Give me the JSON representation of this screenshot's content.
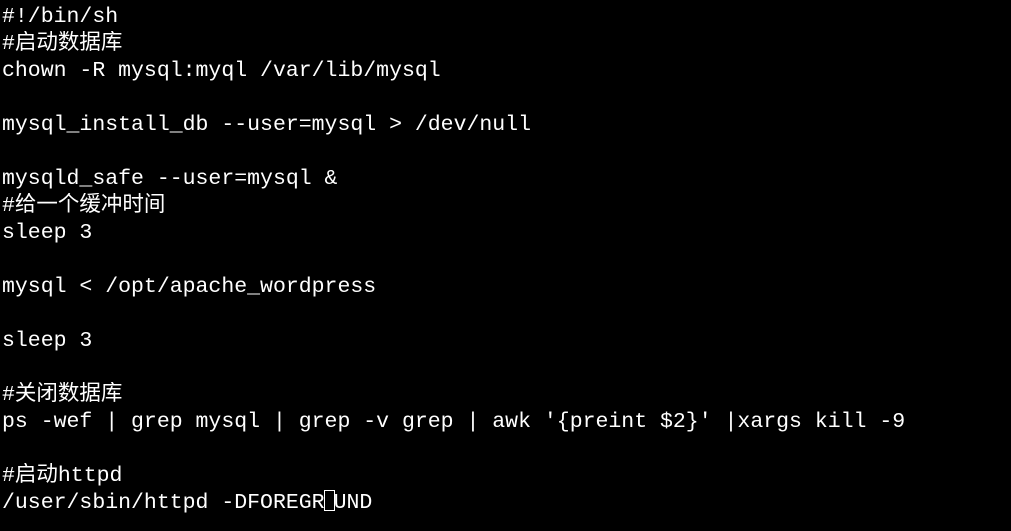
{
  "terminal": {
    "lines": [
      "#!/bin/sh",
      "#启动数据库",
      "chown -R mysql:myql /var/lib/mysql",
      "",
      "mysql_install_db --user=mysql > /dev/null",
      "",
      "mysqld_safe --user=mysql &",
      "#给一个缓冲时间",
      "sleep 3",
      "",
      "mysql < /opt/apache_wordpress",
      "",
      "sleep 3",
      "",
      "#关闭数据库",
      "ps -wef | grep mysql | grep -v grep | awk '{preint $2}' |xargs kill -9",
      "",
      "#启动httpd"
    ],
    "last_line_before_cursor": "/user/sbin/httpd -DFOREGR",
    "last_line_after_cursor": "UND"
  },
  "colors": {
    "background": "#000000",
    "text": "#ffffff"
  }
}
